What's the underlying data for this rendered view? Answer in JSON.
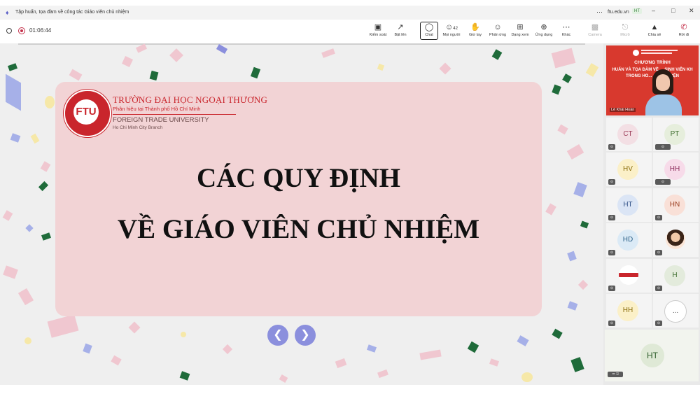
{
  "window": {
    "title": "Tập huấn, tọa đàm về công tác Giáo viên chủ nhiệm",
    "domain": "ftu.edu.vn",
    "user_initials": "HT",
    "more_icon": "ellipsis-icon"
  },
  "toolbar": {
    "timer": "01:06:44",
    "buttons": [
      {
        "label": "Kiểm soát",
        "icon": "control-icon"
      },
      {
        "label": "Bật lên",
        "icon": "popout-icon"
      },
      {
        "label": "Chat",
        "icon": "chat-icon"
      },
      {
        "label": "Mọi người",
        "icon": "people-icon",
        "count": "42"
      },
      {
        "label": "Giơ tay",
        "icon": "raise-hand-icon"
      },
      {
        "label": "Phản ứng",
        "icon": "smiley-icon"
      },
      {
        "label": "Dạng xem",
        "icon": "grid-icon"
      },
      {
        "label": "Ứng dụng",
        "icon": "add-app-icon"
      },
      {
        "label": "Khác",
        "icon": "ellipsis-icon"
      },
      {
        "label": "Camera",
        "icon": "camera-off-icon"
      },
      {
        "label": "Micrô",
        "icon": "mic-off-icon"
      },
      {
        "label": "Chia sẻ",
        "icon": "share-icon"
      },
      {
        "label": "Rời đi",
        "icon": "hang-up-icon"
      }
    ]
  },
  "slide": {
    "university_vi": "TRƯỜNG ĐẠI HỌC NGOẠI THƯƠNG",
    "branch_vi": "Phân hiệu tại Thành phố Hồ Chí Minh",
    "university_en": "FOREIGN TRADE UNIVERSITY",
    "branch_en": "Ho Chi Minh City Branch",
    "heading_line1": "CÁC QUY ĐỊNH",
    "heading_line2": "VỀ GIÁO VIÊN CHỦ NHIỆM"
  },
  "featured": {
    "name": "Lê Khải Hoàn",
    "banner_line1": "CHƯƠNG TRÌNH",
    "banner_line2": "HUẤN VÀ TỌA ĐÀM VỀ ... SINH VIÊN KH",
    "banner_line3": "TRONG HO... ... ỆN LUYỆN"
  },
  "participants": [
    {
      "initials": "CT",
      "bg": "#f3dfe4",
      "fg": "#9b3b57"
    },
    {
      "initials": "PT",
      "bg": "#e6eedc",
      "fg": "#3f6e2f"
    },
    {
      "initials": "HV",
      "bg": "#fbf0c8",
      "fg": "#8a6d0b"
    },
    {
      "initials": "HH",
      "bg": "#f7dbe9",
      "fg": "#8b2a5a"
    },
    {
      "initials": "HT",
      "bg": "#dbe5f5",
      "fg": "#2f4f85"
    },
    {
      "initials": "HN",
      "bg": "#f9e0d7",
      "fg": "#9a3d1f"
    },
    {
      "initials": "HD",
      "bg": "#dbeaf6",
      "fg": "#2a5f86"
    },
    {
      "initials": "",
      "bg": "#fbe5d6",
      "fg": "#333"
    },
    {
      "initials": "",
      "bg": "#ffffff",
      "fg": "#333"
    },
    {
      "initials": "H",
      "bg": "#e3ebdc",
      "fg": "#3f6e2f"
    },
    {
      "initials": "HH",
      "bg": "#fbf0c8",
      "fg": "#8a6d0b"
    },
    {
      "initials": "...",
      "bg": "#ffffff",
      "fg": "#555"
    }
  ],
  "self_tile": {
    "initials": "HT"
  }
}
